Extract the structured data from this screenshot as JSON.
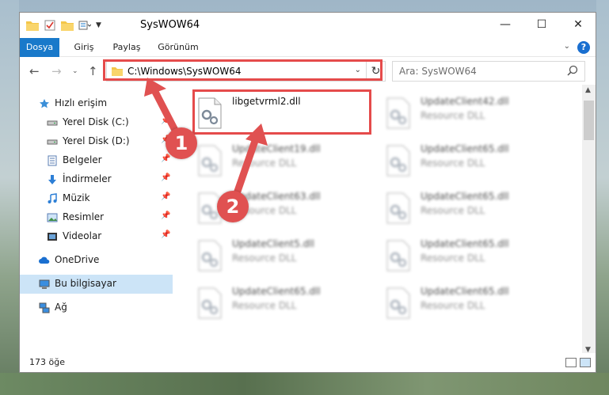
{
  "window": {
    "title": "SysWOW64",
    "controls": {
      "minimize": "—",
      "maximize": "☐",
      "close": "✕"
    }
  },
  "ribbon": {
    "tabs": [
      "Dosya",
      "Giriş",
      "Paylaş",
      "Görünüm"
    ],
    "help": "?"
  },
  "navigation": {
    "address": "C:\\Windows\\SysWOW64",
    "search_placeholder": "Ara: SysWOW64"
  },
  "sidebar": {
    "items": [
      {
        "label": "Hızlı erişim",
        "icon": "star-icon"
      },
      {
        "label": "Yerel Disk (C:)",
        "icon": "drive-icon",
        "pinned": true
      },
      {
        "label": "Yerel Disk (D:)",
        "icon": "drive-icon",
        "pinned": true
      },
      {
        "label": "Belgeler",
        "icon": "documents-icon",
        "pinned": true
      },
      {
        "label": "İndirmeler",
        "icon": "downloads-icon",
        "pinned": true
      },
      {
        "label": "Müzik",
        "icon": "music-icon",
        "pinned": true
      },
      {
        "label": "Resimler",
        "icon": "pictures-icon",
        "pinned": true
      },
      {
        "label": "Videolar",
        "icon": "videos-icon",
        "pinned": true
      },
      {
        "label": "OneDrive",
        "icon": "cloud-icon"
      },
      {
        "label": "Bu bilgisayar",
        "icon": "computer-icon",
        "selected": true
      },
      {
        "label": "Ağ",
        "icon": "network-icon"
      }
    ]
  },
  "files": [
    {
      "name": "libgetvrml2.dll",
      "type": ""
    },
    {
      "name": "UpdateClient42.dll",
      "type": "Resource DLL"
    },
    {
      "name": "UpdateClient19.dll",
      "type": "Resource DLL"
    },
    {
      "name": "UpdateClient65.dll",
      "type": "Resource DLL"
    },
    {
      "name": "UpdateClient63.dll",
      "type": "Resource DLL"
    },
    {
      "name": "UpdateClient65.dll",
      "type": "Resource DLL"
    },
    {
      "name": "UpdateClient5.dll",
      "type": "Resource DLL"
    },
    {
      "name": "UpdateClient65.dll",
      "type": "Resource DLL"
    },
    {
      "name": "UpdateClient65.dll",
      "type": "Resource DLL"
    },
    {
      "name": "UpdateClient65.dll",
      "type": "Resource DLL"
    }
  ],
  "status": {
    "count": "173 öğe"
  },
  "annotations": {
    "marker1": "1",
    "marker2": "2"
  },
  "colors": {
    "accent": "#1979ca",
    "highlight": "#e54b4b",
    "selected": "#cce4f7"
  }
}
